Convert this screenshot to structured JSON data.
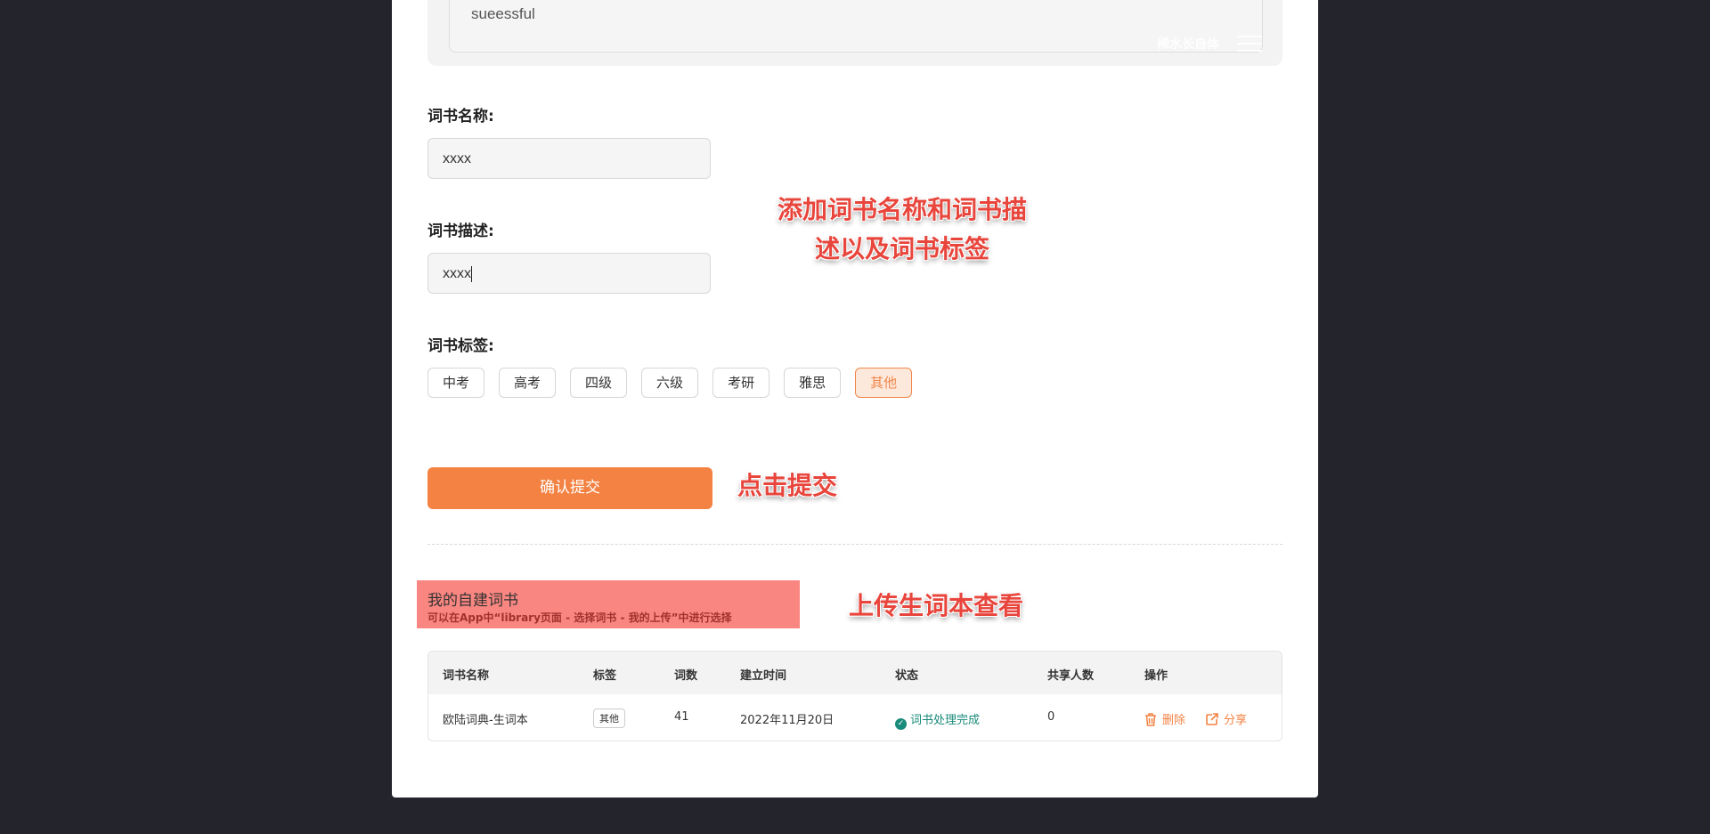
{
  "log": {
    "text": "sueessful"
  },
  "watermark": "稀水长自体",
  "form": {
    "name_label": "词书名称:",
    "name_value": "xxxx",
    "desc_label": "词书描述:",
    "desc_value": "xxxx",
    "tags_label": "词书标签:",
    "tags": [
      "中考",
      "高考",
      "四级",
      "六级",
      "考研",
      "雅思",
      "其他"
    ],
    "selected_tag": "其他",
    "submit_label": "确认提交"
  },
  "my_books": {
    "title": "我的自建词书",
    "subtitle": "可以在App中“library页面 - 选择词书 - 我的上传”中进行选择"
  },
  "table": {
    "headers": [
      "词书名称",
      "标签",
      "词数",
      "建立时间",
      "状态",
      "共享人数",
      "操作"
    ],
    "row": {
      "name": "欧陆词典-生词本",
      "tag": "其他",
      "count": "41",
      "created": "2022年11月20日",
      "status": "词书处理完成",
      "shared": "0",
      "delete_label": "删除",
      "share_label": "分享"
    }
  },
  "annotations": {
    "add_info_line1": "添加词书名称和词书描",
    "add_info_line2": "述以及词书标签",
    "click_submit": "点击提交",
    "view_upload": "上传生词本查看"
  },
  "colors": {
    "accent": "#f38243",
    "background": "#24242c",
    "annotation": "#e8453c",
    "status": "#1a8a7a"
  }
}
